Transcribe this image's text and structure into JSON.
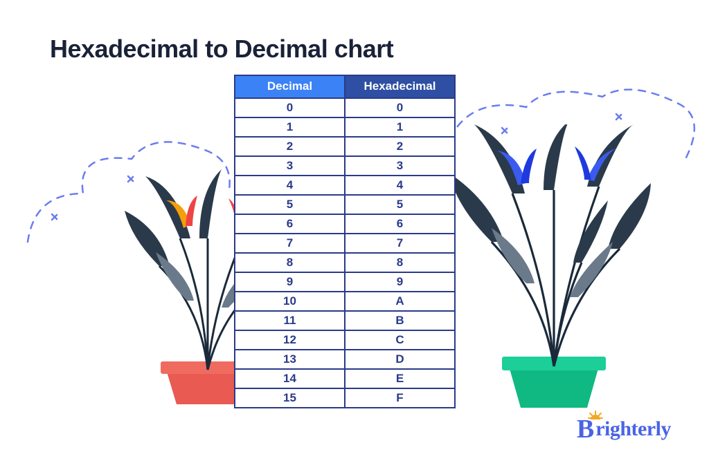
{
  "title": "Hexadecimal to Decimal chart",
  "headers": {
    "decimal": "Decimal",
    "hex": "Hexadecimal"
  },
  "logo": {
    "b": "B",
    "rest": "righterly"
  },
  "chart_data": {
    "type": "table",
    "title": "Hexadecimal to Decimal chart",
    "columns": [
      "Decimal",
      "Hexadecimal"
    ],
    "rows": [
      {
        "decimal": "0",
        "hex": "0"
      },
      {
        "decimal": "1",
        "hex": "1"
      },
      {
        "decimal": "2",
        "hex": "2"
      },
      {
        "decimal": "3",
        "hex": "3"
      },
      {
        "decimal": "4",
        "hex": "4"
      },
      {
        "decimal": "5",
        "hex": "5"
      },
      {
        "decimal": "6",
        "hex": "6"
      },
      {
        "decimal": "7",
        "hex": "7"
      },
      {
        "decimal": "8",
        "hex": "8"
      },
      {
        "decimal": "9",
        "hex": "9"
      },
      {
        "decimal": "10",
        "hex": "A"
      },
      {
        "decimal": "11",
        "hex": "B"
      },
      {
        "decimal": "12",
        "hex": "C"
      },
      {
        "decimal": "13",
        "hex": "D"
      },
      {
        "decimal": "14",
        "hex": "E"
      },
      {
        "decimal": "15",
        "hex": "F"
      }
    ]
  }
}
